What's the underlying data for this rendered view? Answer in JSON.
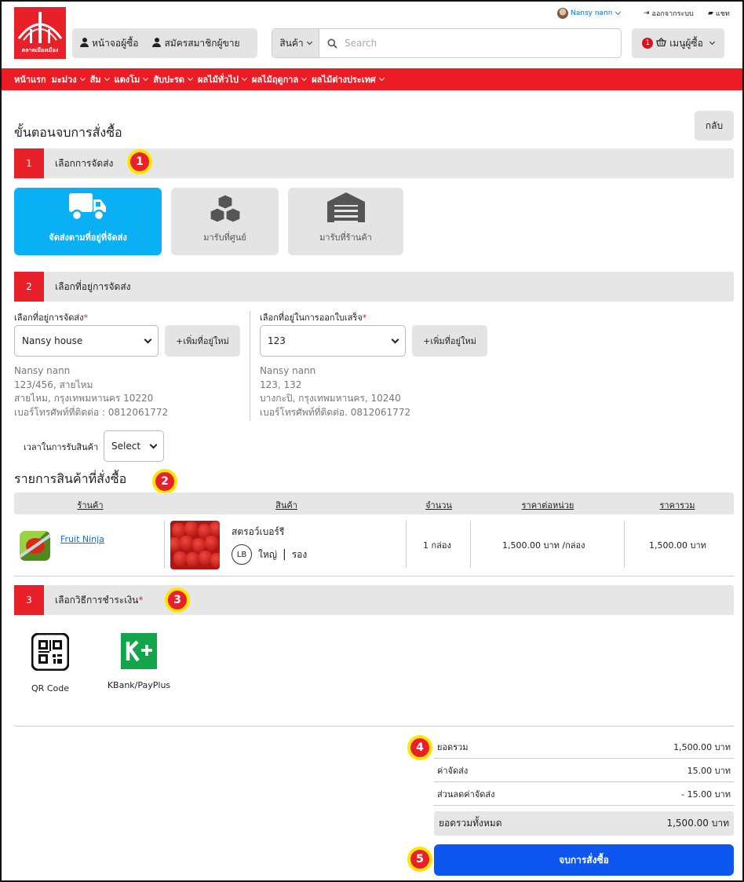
{
  "brand": {
    "logo_text": "ตลาดเมืองเมือง",
    "red": "#e8202a"
  },
  "topbar": {
    "user_name": "Nansy nann",
    "logout_label": "ออกจากระบบ",
    "chat_label": "แชท"
  },
  "header": {
    "buyer_home_label": "หน้าจอผู้ซื้อ",
    "seller_signup_label": "สมัครสมาชิกผู้ขาย",
    "search_category": "สินค้า",
    "search_placeholder": "Search",
    "cart_count": "1",
    "buyer_menu_label": "เมนูผู้ซื้อ"
  },
  "nav": {
    "items": [
      "หน้าแรก",
      "มะม่วง",
      "ส้ม",
      "แตงโม",
      "สับปะรด",
      "ผลไม้ทั่วไป",
      "ผลไม้ฤดูกาล",
      "ผลไม้ต่างประเทศ"
    ]
  },
  "page": {
    "title": "ขั้นตอนจบการสั่งซื้อ",
    "back_label": "กลับ"
  },
  "steps": {
    "s1": {
      "num": "1",
      "label": "เลือกการจัดส่ง",
      "marker": "1"
    },
    "s2": {
      "num": "2",
      "label": "เลือกที่อยู่การจัดส่ง"
    },
    "s3": {
      "num": "3",
      "label": "เลือกวิธีการชำระเงิน",
      "required": "*",
      "marker": "3"
    }
  },
  "delivery_options": [
    {
      "label": "จัดส่งตามที่อยู่ที่จัดส่ง",
      "icon": "truck-icon",
      "selected": true
    },
    {
      "label": "มารับที่ศูนย์",
      "icon": "boxes-icon",
      "selected": false
    },
    {
      "label": "มารับที่ร้านค้า",
      "icon": "warehouse-icon",
      "selected": false
    }
  ],
  "shipping": {
    "label": "เลือกที่อยู่การจัดส่ง",
    "required": "*",
    "selected": "Nansy house",
    "add_label": "+เพิ่มที่อยู่ใหม่",
    "address_lines": [
      "Nansy nann",
      "123/456, สายไหม",
      "สายไหม, กรุงเทพมหานคร 10220",
      "เบอร์โทรศัพท์ที่ติดต่อ : 0812061772"
    ]
  },
  "billing": {
    "label": "เลือกที่อยู่ในการออกใบเสร็จ",
    "required": "*",
    "selected": "123",
    "add_label": "+เพิ่มที่อยู่ใหม่",
    "address_lines": [
      "Nansy nann",
      "123, 132",
      "บางกะปิ, กรุงเทพมหานคร, 10240",
      "เบอร์โทรศัพท์ที่ติดต่อ. 0812061772"
    ]
  },
  "pickup_time": {
    "label": "เวลาในการรับสินค้า",
    "selected": "Select"
  },
  "items_section": {
    "title": "รายการสินค้าที่สั่งซื้อ",
    "marker": "2"
  },
  "table": {
    "headers": [
      "ร้านค้า",
      "สินค้า",
      "จำนวน",
      "ราคาต่อหน่วย",
      "ราคารวม"
    ],
    "rows": [
      {
        "shop": "Fruit Ninja",
        "product": "สตรอว์เบอร์รี",
        "grade_badge": "LB",
        "size": "ใหญ่",
        "grade": "รอง",
        "qty": "1 กล่อง",
        "unit_price": "1,500.00 บาท /กล่อง",
        "total": "1,500.00 บาท"
      }
    ]
  },
  "payment_methods": [
    {
      "label": "QR Code",
      "icon": "qr-code-icon"
    },
    {
      "label": "KBank/PayPlus",
      "icon": "kplus-icon"
    }
  ],
  "summary": {
    "marker": "4",
    "rows": [
      {
        "label": "ยอดรวม",
        "value": "1,500.00 บาท"
      },
      {
        "label": "ค่าจัดส่ง",
        "value": "15.00 บาท"
      },
      {
        "label": "ส่วนลดค่าจัดส่ง",
        "value": "- 15.00 บาท"
      }
    ],
    "grand_label": "ยอดรวมทั้งหมด",
    "grand_value": "1,500.00 บาท"
  },
  "confirm": {
    "label": "จบการสั่งซื้อ",
    "marker": "5"
  }
}
